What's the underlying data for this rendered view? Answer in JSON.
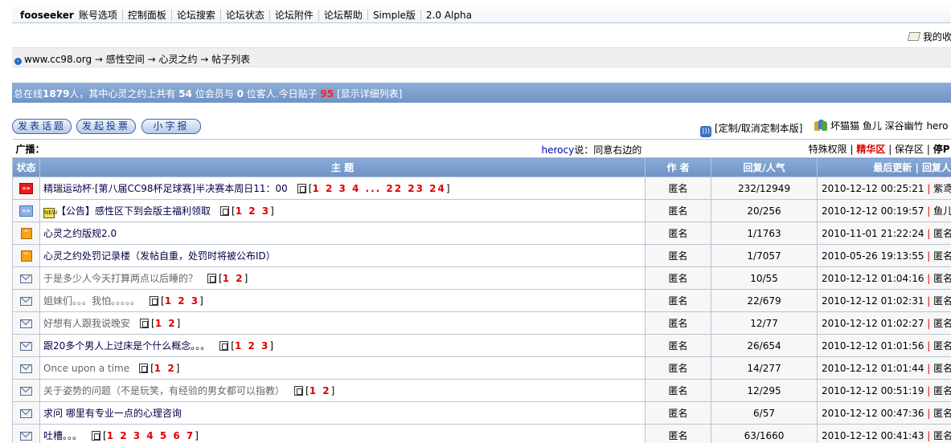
{
  "topnav": {
    "user": "fooseeker",
    "items": [
      "账号选项",
      "控制面板",
      "论坛搜索",
      "论坛状态",
      "论坛附件",
      "论坛帮助",
      "Simple版",
      "2.0 Alpha"
    ]
  },
  "fav_label": "我的收",
  "breadcrumb": "www.cc98.org → 感性空间 → 心灵之约 → 帖子列表",
  "online": {
    "prefix": "总在线",
    "total": "1879",
    "mid1": "人，其中心灵之约上共有 ",
    "members": "54",
    "mid2": " 位会员与 ",
    "guests": "0",
    "mid3": " 位客人.今日贴子 ",
    "today": "95",
    "detail_link": "[显示详细列表]"
  },
  "buttons": {
    "new_topic": "发表话题",
    "new_vote": "发起投票",
    "small_report": "小字报"
  },
  "rss_label": "[定制/取消定制本版]",
  "moderators": "坏猫猫 鱼儿 深谷幽竹 hero",
  "broadcast": {
    "label": "广播：",
    "author": "herocy",
    "said": "说：同意右边的",
    "special": "特殊权限",
    "elite": "精华区",
    "save": "保存区",
    "stop": "停P"
  },
  "table": {
    "headers": [
      "状态",
      "主 题",
      "作 者",
      "回复/人气",
      "最后更新 | 回复人"
    ],
    "rows": [
      {
        "icon": "hot-topic-icon",
        "title": "精瑞运动杯·[第八届CC98杯足球赛]半决赛本周日11：00",
        "pages_pre": "[",
        "pages": "1 2 3 4 ... 22 23 24",
        "pages_post": "]",
        "author": "匿名",
        "stats": "232/12949",
        "updated": "2010-12-12 00:25:21",
        "replier": "紫鸢",
        "style": "blue"
      },
      {
        "icon": "announcement-icon",
        "title": "【公告】感性区下到会版主福利领取",
        "pages_pre": "[",
        "pages": "1 2 3",
        "pages_post": "]",
        "author": "匿名",
        "stats": "20/256",
        "updated": "2010-12-12 00:19:57",
        "replier": "鱼儿",
        "style": "blue"
      },
      {
        "icon": "pinned-icon",
        "title": "心灵之约版规2.0",
        "pages_pre": "",
        "pages": "",
        "pages_post": "",
        "author": "匿名",
        "stats": "1/1763",
        "updated": "2010-11-01 21:22:24",
        "replier": "匿名",
        "style": "blue"
      },
      {
        "icon": "pinned-icon",
        "title": "心灵之约处罚记录楼（发帖自重，处罚时将被公布ID）",
        "pages_pre": "",
        "pages": "",
        "pages_post": "",
        "author": "匿名",
        "stats": "1/7057",
        "updated": "2010-05-26 19:13:55",
        "replier": "匿名",
        "style": "blue"
      },
      {
        "icon": "envelope-icon",
        "title": "于是多少人今天打算两点以后睡的？",
        "pages_pre": "[",
        "pages": "1 2",
        "pages_post": "]",
        "author": "匿名",
        "stats": "10/55",
        "updated": "2010-12-12 01:04:16",
        "replier": "匿名",
        "style": "grey"
      },
      {
        "icon": "envelope-icon",
        "title": "姐妹们。。。我怕。。。。。",
        "pages_pre": "[",
        "pages": "1 2 3",
        "pages_post": "]",
        "author": "匿名",
        "stats": "22/679",
        "updated": "2010-12-12 01:02:31",
        "replier": "匿名",
        "style": "grey"
      },
      {
        "icon": "envelope-icon",
        "title": "好想有人跟我说晚安",
        "pages_pre": "[",
        "pages": "1 2",
        "pages_post": "]",
        "author": "匿名",
        "stats": "12/77",
        "updated": "2010-12-12 01:02:27",
        "replier": "匿名",
        "style": "grey"
      },
      {
        "icon": "envelope-icon",
        "title": "跟20多个男人上过床是个什么概念。。。",
        "pages_pre": "[",
        "pages": "1 2 3",
        "pages_post": "]",
        "author": "匿名",
        "stats": "26/654",
        "updated": "2010-12-12 01:01:56",
        "replier": "匿名",
        "style": "blue"
      },
      {
        "icon": "envelope-icon",
        "title": "Once upon a time",
        "pages_pre": "[",
        "pages": "1 2",
        "pages_post": "]",
        "author": "匿名",
        "stats": "14/277",
        "updated": "2010-12-12 01:01:44",
        "replier": "匿名",
        "style": "grey"
      },
      {
        "icon": "envelope-icon",
        "title": "关于姿势的问题（不是玩笑，有经验的男女都可以指教）",
        "pages_pre": "[",
        "pages": "1 2",
        "pages_post": "]",
        "author": "匿名",
        "stats": "12/295",
        "updated": "2010-12-12 00:51:19",
        "replier": "匿名",
        "style": "grey"
      },
      {
        "icon": "envelope-icon",
        "title": "求问 哪里有专业一点的心理咨询",
        "pages_pre": "",
        "pages": "",
        "pages_post": "",
        "author": "匿名",
        "stats": "6/57",
        "updated": "2010-12-12 00:47:36",
        "replier": "匿名",
        "style": "blue"
      },
      {
        "icon": "envelope-icon",
        "title": "吐槽。。。",
        "pages_pre": "[",
        "pages": "1 2 3 4 5 6 7",
        "pages_post": "]",
        "author": "匿名",
        "stats": "63/1660",
        "updated": "2010-12-12 00:41:43",
        "replier": "匿名",
        "style": "blue"
      }
    ]
  },
  "colors": {
    "header_blue": "#7b9fd0",
    "page_red": "#e00000",
    "link_navy": "#00004a"
  }
}
